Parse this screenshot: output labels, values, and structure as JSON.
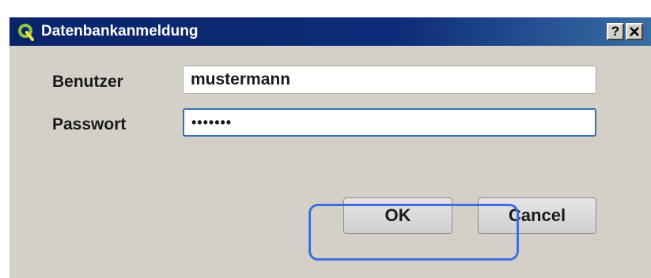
{
  "window": {
    "title": "Datenbankanmeldung",
    "help_label": "?"
  },
  "form": {
    "user_label": "Benutzer",
    "user_value": "mustermann",
    "password_label": "Passwort",
    "password_masked": "•••••••"
  },
  "buttons": {
    "ok_label": "OK",
    "cancel_label": "Cancel"
  },
  "icons": {
    "app": "qgis-icon",
    "close": "close-icon"
  },
  "colors": {
    "titlebar": "#0a246a",
    "dialog_bg": "#d4d0c8",
    "highlight": "#3f6fe0",
    "focus_border": "#3470b9"
  }
}
